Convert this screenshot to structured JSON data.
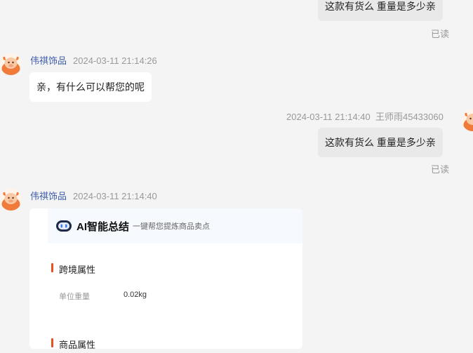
{
  "messages": [
    {
      "side": "right",
      "text": "这款有货么  重量是多少亲",
      "read": "已读"
    },
    {
      "side": "left",
      "shop": "伟祺饰品",
      "time": "2024-03-11 21:14:26",
      "text": "亲，有什么可以帮您的呢"
    },
    {
      "side": "right",
      "time": "2024-03-11 21:14:40",
      "sender": "王师雨45433060",
      "text": "这款有货么  重量是多少亲",
      "read": "已读"
    },
    {
      "side": "left",
      "shop": "伟祺饰品",
      "time": "2024-03-11 21:14:40"
    }
  ],
  "ai_card": {
    "title": "AI智能总结",
    "subtitle": "一键帮您提炼商品卖点",
    "sections": [
      {
        "title": "跨境属性",
        "rows": [
          {
            "label": "单位重量",
            "value": "0.02kg"
          }
        ]
      },
      {
        "title": "商品属性"
      }
    ]
  },
  "colors": {
    "page_bg": "#f4f4f4",
    "right_bubble": "#e9e9e9",
    "left_bubble": "#ffffff",
    "shop_name": "#3c5ba8",
    "accent": "#e8511f"
  },
  "icons": {
    "avatar": "cartoon-cow-avatar",
    "ai": "robot-icon"
  }
}
